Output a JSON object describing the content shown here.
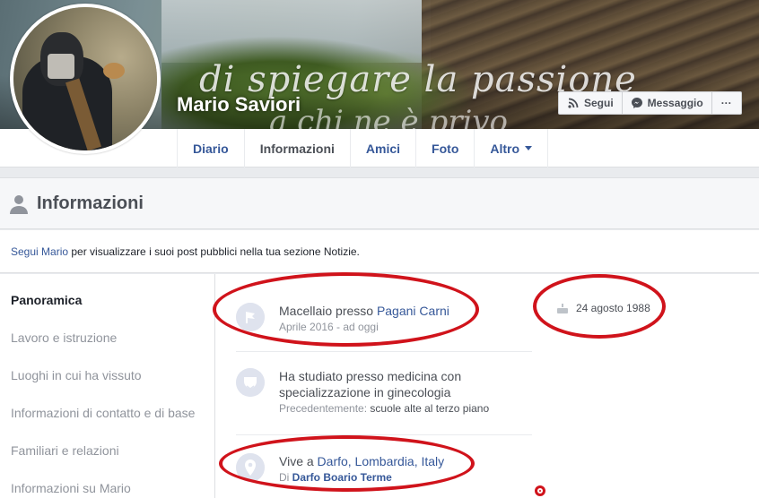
{
  "profile": {
    "name": "Mario Saviori",
    "cover_text_line1": "di spiegare la passione",
    "cover_text_line2": "a chi ne è privo"
  },
  "actions": {
    "follow": "Segui",
    "message": "Messaggio",
    "more": "···"
  },
  "tabs": [
    {
      "label": "Diario",
      "active": false
    },
    {
      "label": "Informazioni",
      "active": true
    },
    {
      "label": "Amici",
      "active": false
    },
    {
      "label": "Foto",
      "active": false
    },
    {
      "label": "Altro",
      "active": false
    }
  ],
  "section": {
    "title": "Informazioni"
  },
  "follow_note": {
    "link": "Segui Mario",
    "text": " per visualizzare i suoi post pubblici nella tua sezione Notizie."
  },
  "sidebar": {
    "items": [
      {
        "label": "Panoramica",
        "active": true
      },
      {
        "label": "Lavoro e istruzione",
        "active": false
      },
      {
        "label": "Luoghi in cui ha vissuto",
        "active": false
      },
      {
        "label": "Informazioni di contatto e di base",
        "active": false
      },
      {
        "label": "Familiari e relazioni",
        "active": false
      },
      {
        "label": "Informazioni su Mario",
        "active": false
      }
    ]
  },
  "overview": {
    "work": {
      "prefix": "Macellaio presso ",
      "place": "Pagani Carni",
      "period": "Aprile 2016 - ad oggi"
    },
    "education": {
      "line1": "Ha studiato presso medicina con",
      "line2": "specializzazione in ginecologia",
      "previous_label": "Precedentemente: ",
      "previous_value": "scuole alte al terzo piano"
    },
    "lives": {
      "prefix": "Vive a ",
      "place": "Darfo, Lombardia, Italy",
      "from_label": "Di ",
      "from_value": "Darfo Boario Terme"
    },
    "birthday": "24 agosto 1988"
  },
  "colors": {
    "link": "#365899",
    "annotation_red": "#d0131b",
    "header_bg": "#f6f7f9",
    "page_bg": "#e9ebee"
  }
}
